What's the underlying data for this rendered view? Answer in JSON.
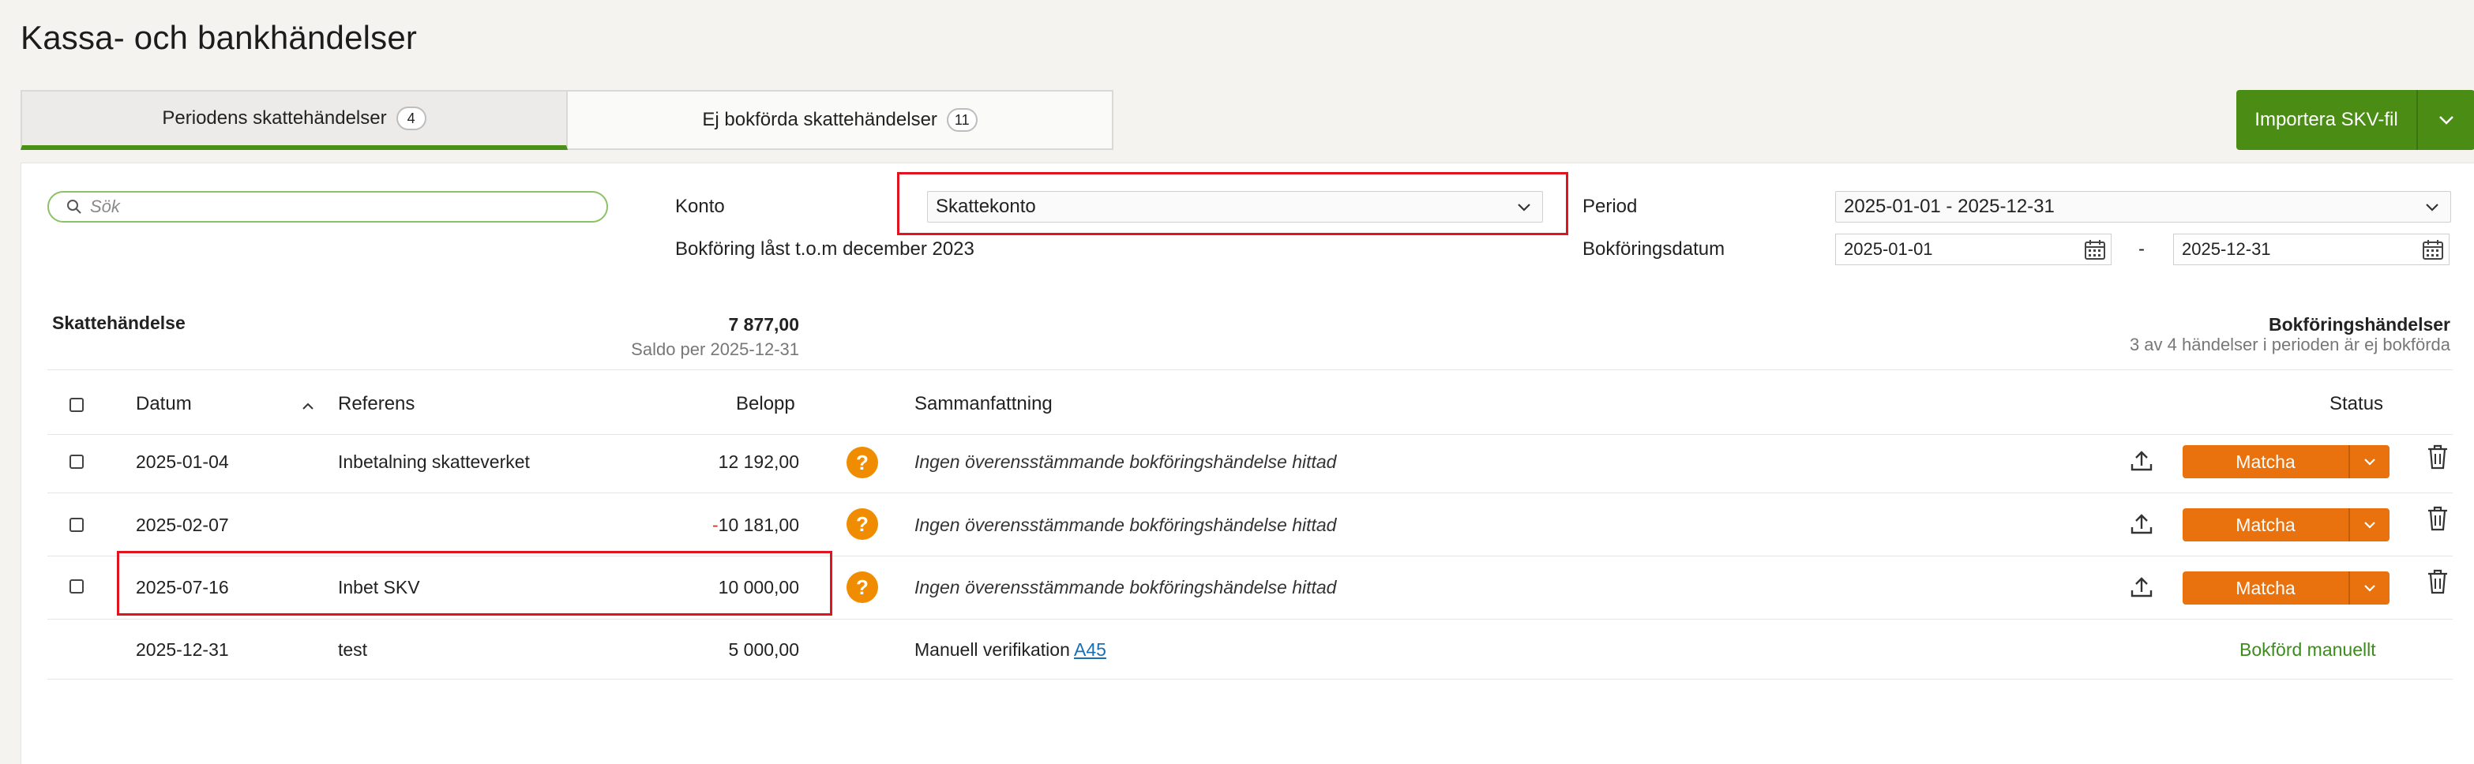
{
  "title": "Kassa- och bankhändelser",
  "tabs": [
    {
      "label": "Periodens skattehändelser",
      "count": "4"
    },
    {
      "label": "Ej bokförda skattehändelser",
      "count": "11"
    }
  ],
  "import_button": "Importera SKV-fil",
  "search": {
    "placeholder": "Sök"
  },
  "konto": {
    "label": "Konto",
    "value": "Skattekonto",
    "locked_note": "Bokföring låst t.o.m december 2023"
  },
  "period": {
    "label": "Period",
    "value": "2025-01-01 - 2025-12-31"
  },
  "bokforingsdatum": {
    "label": "Bokföringsdatum",
    "from": "2025-01-01",
    "separator": "-",
    "to": "2025-12-31"
  },
  "summary": {
    "left_title": "Skattehändelse",
    "value": "7 877,00",
    "saldo": "Saldo per 2025-12-31",
    "right_title": "Bokföringshändelser",
    "right_sub": "3 av 4 händelser i perioden är ej bokförda"
  },
  "columns": {
    "datum": "Datum",
    "referens": "Referens",
    "belopp": "Belopp",
    "sammanfattning": "Sammanfattning",
    "status": "Status"
  },
  "rows": [
    {
      "datum": "2025-01-04",
      "referens": "Inbetalning skatteverket",
      "belopp": "12 192,00",
      "summary": "Ingen överensstämmande bokföringshändelse hittad",
      "action": "Matcha"
    },
    {
      "datum": "2025-02-07",
      "referens": "",
      "belopp": "-10 181,00",
      "summary": "Ingen överensstämmande bokföringshändelse hittad",
      "action": "Matcha"
    },
    {
      "datum": "2025-07-16",
      "referens": "Inbet SKV",
      "belopp": "10 000,00",
      "summary": "Ingen överensstämmande bokföringshändelse hittad",
      "action": "Matcha"
    },
    {
      "datum": "2025-12-31",
      "referens": "test",
      "belopp": "5 000,00",
      "summary_prefix": "Manuell verifikation ",
      "summary_link": "A45",
      "status": "Bokförd manuellt"
    }
  ],
  "icons": {
    "search": "search-icon",
    "chevron": "chevron-down-icon",
    "calendar": "calendar-icon",
    "upload": "upload-icon",
    "trash": "trash-icon",
    "question": "question-icon",
    "sort": "sort-up-icon"
  },
  "colors": {
    "accent_green": "#4a8c14",
    "match_orange": "#e9720e",
    "question_orange": "#f08c00",
    "highlight_red": "#e0141e",
    "status_green": "#3c8c1c",
    "negative_red": "#c0392b"
  }
}
